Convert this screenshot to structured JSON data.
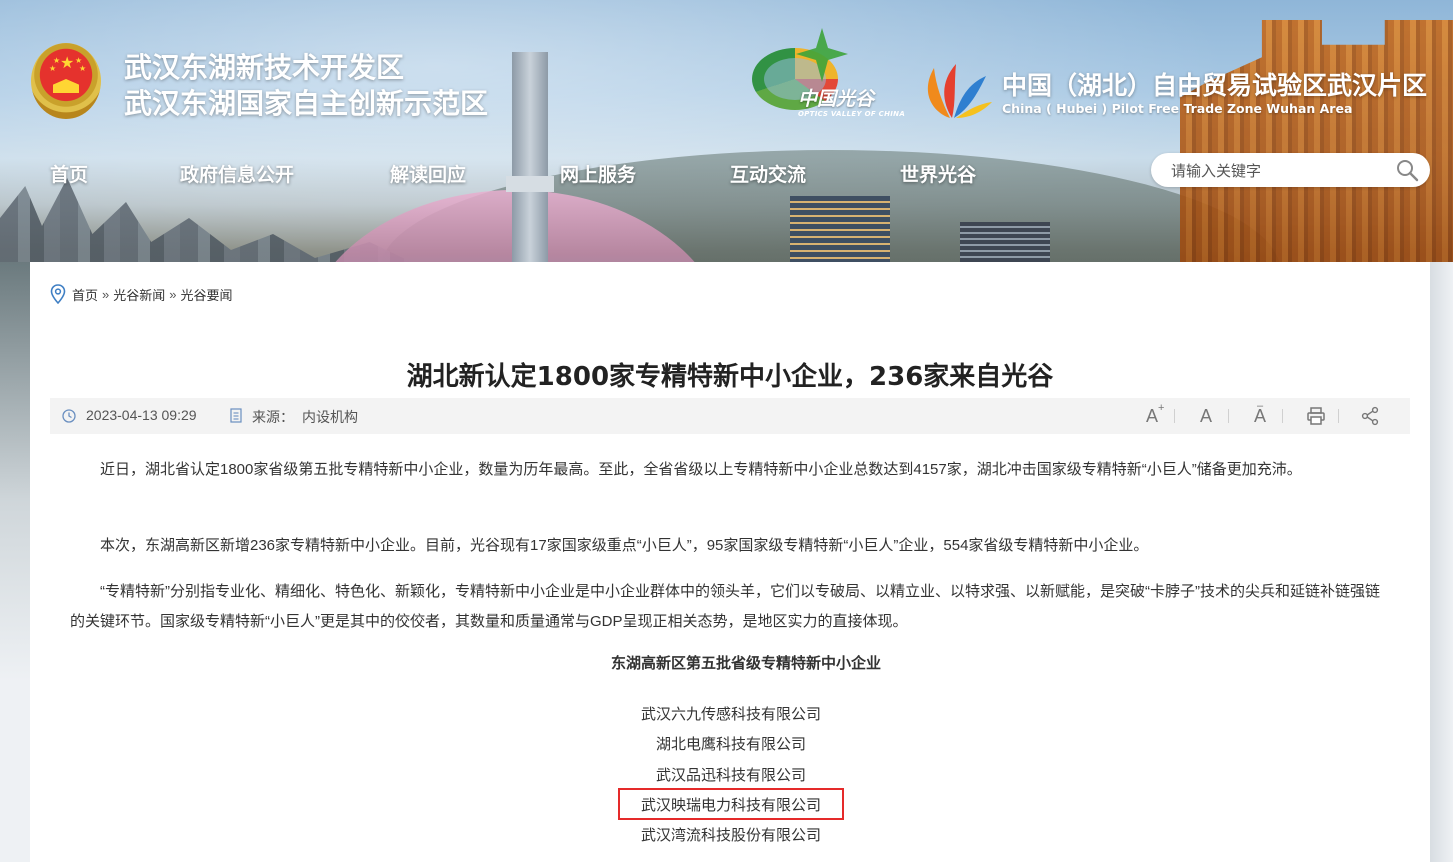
{
  "header": {
    "site_title_line1": "武汉东湖新技术开发区",
    "site_title_line2": "武汉东湖国家自主创新示范区",
    "optics_valley_cn": "中国光谷",
    "optics_valley_en": "OPTICS VALLEY OF CHINA",
    "ftz_title": "中国（湖北）自由贸易试验区武汉片区",
    "ftz_subtitle": "China ( Hubei ) Pilot Free Trade Zone Wuhan Area"
  },
  "nav": {
    "items": [
      "首页",
      "政府信息公开",
      "解读回应",
      "网上服务",
      "互动交流",
      "世界光谷"
    ]
  },
  "search": {
    "placeholder": "请输入关键字"
  },
  "breadcrumb": {
    "items": [
      "首页",
      "光谷新闻",
      "光谷要闻"
    ],
    "separator": "»"
  },
  "article": {
    "title": "湖北新认定1800家专精特新中小企业，236家来自光谷",
    "date": "2023-04-13 09:29",
    "source_label": "来源：",
    "source_value": "内设机构",
    "paragraphs": [
      "近日，湖北省认定1800家省级第五批专精特新中小企业，数量为历年最高。至此，全省省级以上专精特新中小企业总数达到4157家，湖北冲击国家级专精特新“小巨人”储备更加充沛。",
      "本次，东湖高新区新增236家专精特新中小企业。目前，光谷现有17家国家级重点“小巨人”，95家国家级专精特新“小巨人”企业，554家省级专精特新中小企业。",
      "“专精特新”分别指专业化、精细化、特色化、新颖化，专精特新中小企业是中小企业群体中的领头羊，它们以专破局、以精立业、以特求强、以新赋能，是突破“卡脖子”技术的尖兵和延链补链强链的关键环节。国家级专精特新“小巨人”更是其中的佼佼者，其数量和质量通常与GDP呈现正相关态势，是地区实力的直接体现。"
    ],
    "list_title": "东湖高新区第五批省级专精特新中小企业",
    "companies": [
      "武汉六九传感科技有限公司",
      "湖北电鹰科技有限公司",
      "武汉品迅科技有限公司",
      "武汉映瑞电力科技有限公司",
      "武汉湾流科技股份有限公司"
    ],
    "highlighted_company": "武汉映瑞电力科技有限公司"
  },
  "toolbar": {
    "font_increase": "A+",
    "font_normal": "A",
    "font_decrease": "A-",
    "icons": [
      "font-increase-icon",
      "font-normal-icon",
      "font-decrease-icon",
      "print-icon",
      "share-icon"
    ]
  },
  "colors": {
    "highlight": "#e52a2a",
    "title": "#222222",
    "text": "#333333",
    "meta_bg": "#f3f3f3"
  }
}
